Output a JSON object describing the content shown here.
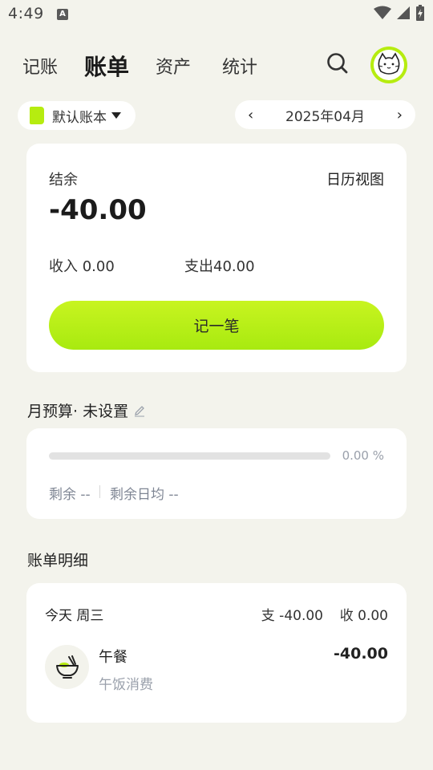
{
  "status_bar": {
    "time": "4:49",
    "notification_glyph": "A",
    "icons": [
      "wifi-icon",
      "signal-icon",
      "battery-charging-icon"
    ]
  },
  "nav": {
    "tabs": [
      "记账",
      "账单",
      "资产",
      "统计"
    ],
    "active_tab": "账单",
    "search_icon": "search-icon",
    "avatar_icon": "cat-avatar-icon"
  },
  "account": {
    "label": "默认账本"
  },
  "month": {
    "label": "2025年04月"
  },
  "summary": {
    "balance_label": "结余",
    "calendar_view": "日历视图",
    "balance_value": "-40.00",
    "income_label": "收入",
    "income_value": "0.00",
    "expense_label": "支出",
    "expense_value": "40.00",
    "record_button": "记一笔"
  },
  "budget": {
    "title": "月预算· 未设置",
    "progress_percent_text": "0.00 %",
    "progress_fraction": 0.0,
    "remaining": "剩余 --",
    "remaining_daily": "剩余日均 --"
  },
  "detail": {
    "title": "账单明细",
    "day": {
      "label": "今天 周三",
      "expense": "支 -40.00",
      "income": "收 0.00",
      "items": [
        {
          "icon": "rice-bowl-icon",
          "name": "午餐",
          "note": "午饭消费",
          "amount": "-40.00"
        }
      ]
    }
  },
  "colors": {
    "background": "#f3f3ec",
    "accent": "#b6ec10",
    "card": "#ffffff",
    "muted_text": "#9aa0ab"
  }
}
